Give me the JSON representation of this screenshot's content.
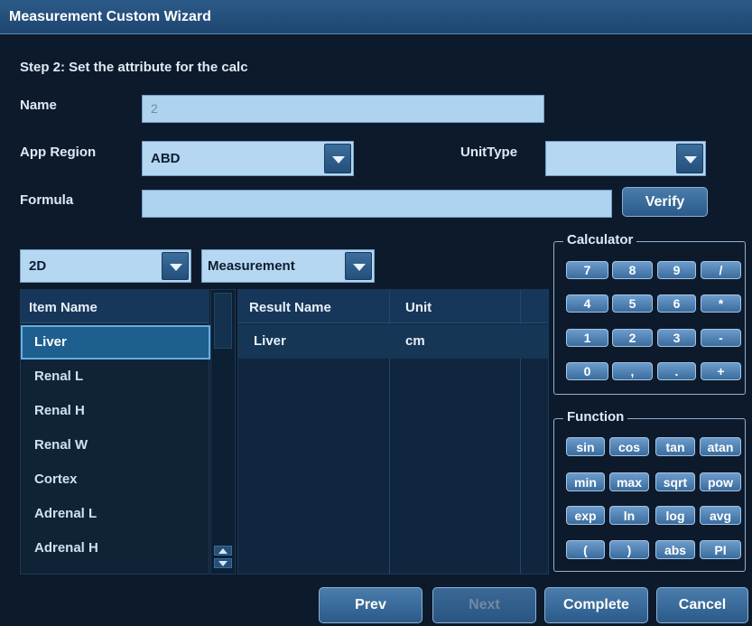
{
  "window": {
    "title": "Measurement Custom Wizard"
  },
  "step": "Step 2: Set the attribute for the calc",
  "form": {
    "name_label": "Name",
    "name_value": "2",
    "app_region_label": "App Region",
    "app_region_value": "ABD",
    "unit_type_label": "UnitType",
    "unit_type_value": "",
    "formula_label": "Formula",
    "formula_value": "",
    "verify_label": "Verify"
  },
  "filters": {
    "mode_value": "2D",
    "type_value": "Measurement"
  },
  "item_list": {
    "header": "Item Name",
    "items": [
      "Liver",
      "Renal L",
      "Renal H",
      "Renal W",
      "Cortex",
      "Adrenal L",
      "Adrenal H"
    ],
    "selected_index": 0
  },
  "result_table": {
    "headers": [
      "Result Name",
      "Unit"
    ],
    "rows": [
      {
        "result_name": "Liver",
        "unit": "cm"
      }
    ]
  },
  "calculator": {
    "title": "Calculator",
    "keys": [
      "7",
      "8",
      "9",
      "/",
      "4",
      "5",
      "6",
      "*",
      "1",
      "2",
      "3",
      "-",
      "0",
      ",",
      ".",
      "+"
    ]
  },
  "function": {
    "title": "Function",
    "keys": [
      "sin",
      "cos",
      "tan",
      "atan",
      "min",
      "max",
      "sqrt",
      "pow",
      "exp",
      "ln",
      "log",
      "avg",
      "(",
      ")",
      "abs",
      "PI"
    ]
  },
  "buttons": {
    "prev": "Prev",
    "next": "Next",
    "complete": "Complete",
    "cancel": "Cancel"
  },
  "colors": {
    "background": "#0d1a2b",
    "titlebar": "#1d4670",
    "field": "#aed3ef",
    "selected_row": "#1d5f8f"
  }
}
